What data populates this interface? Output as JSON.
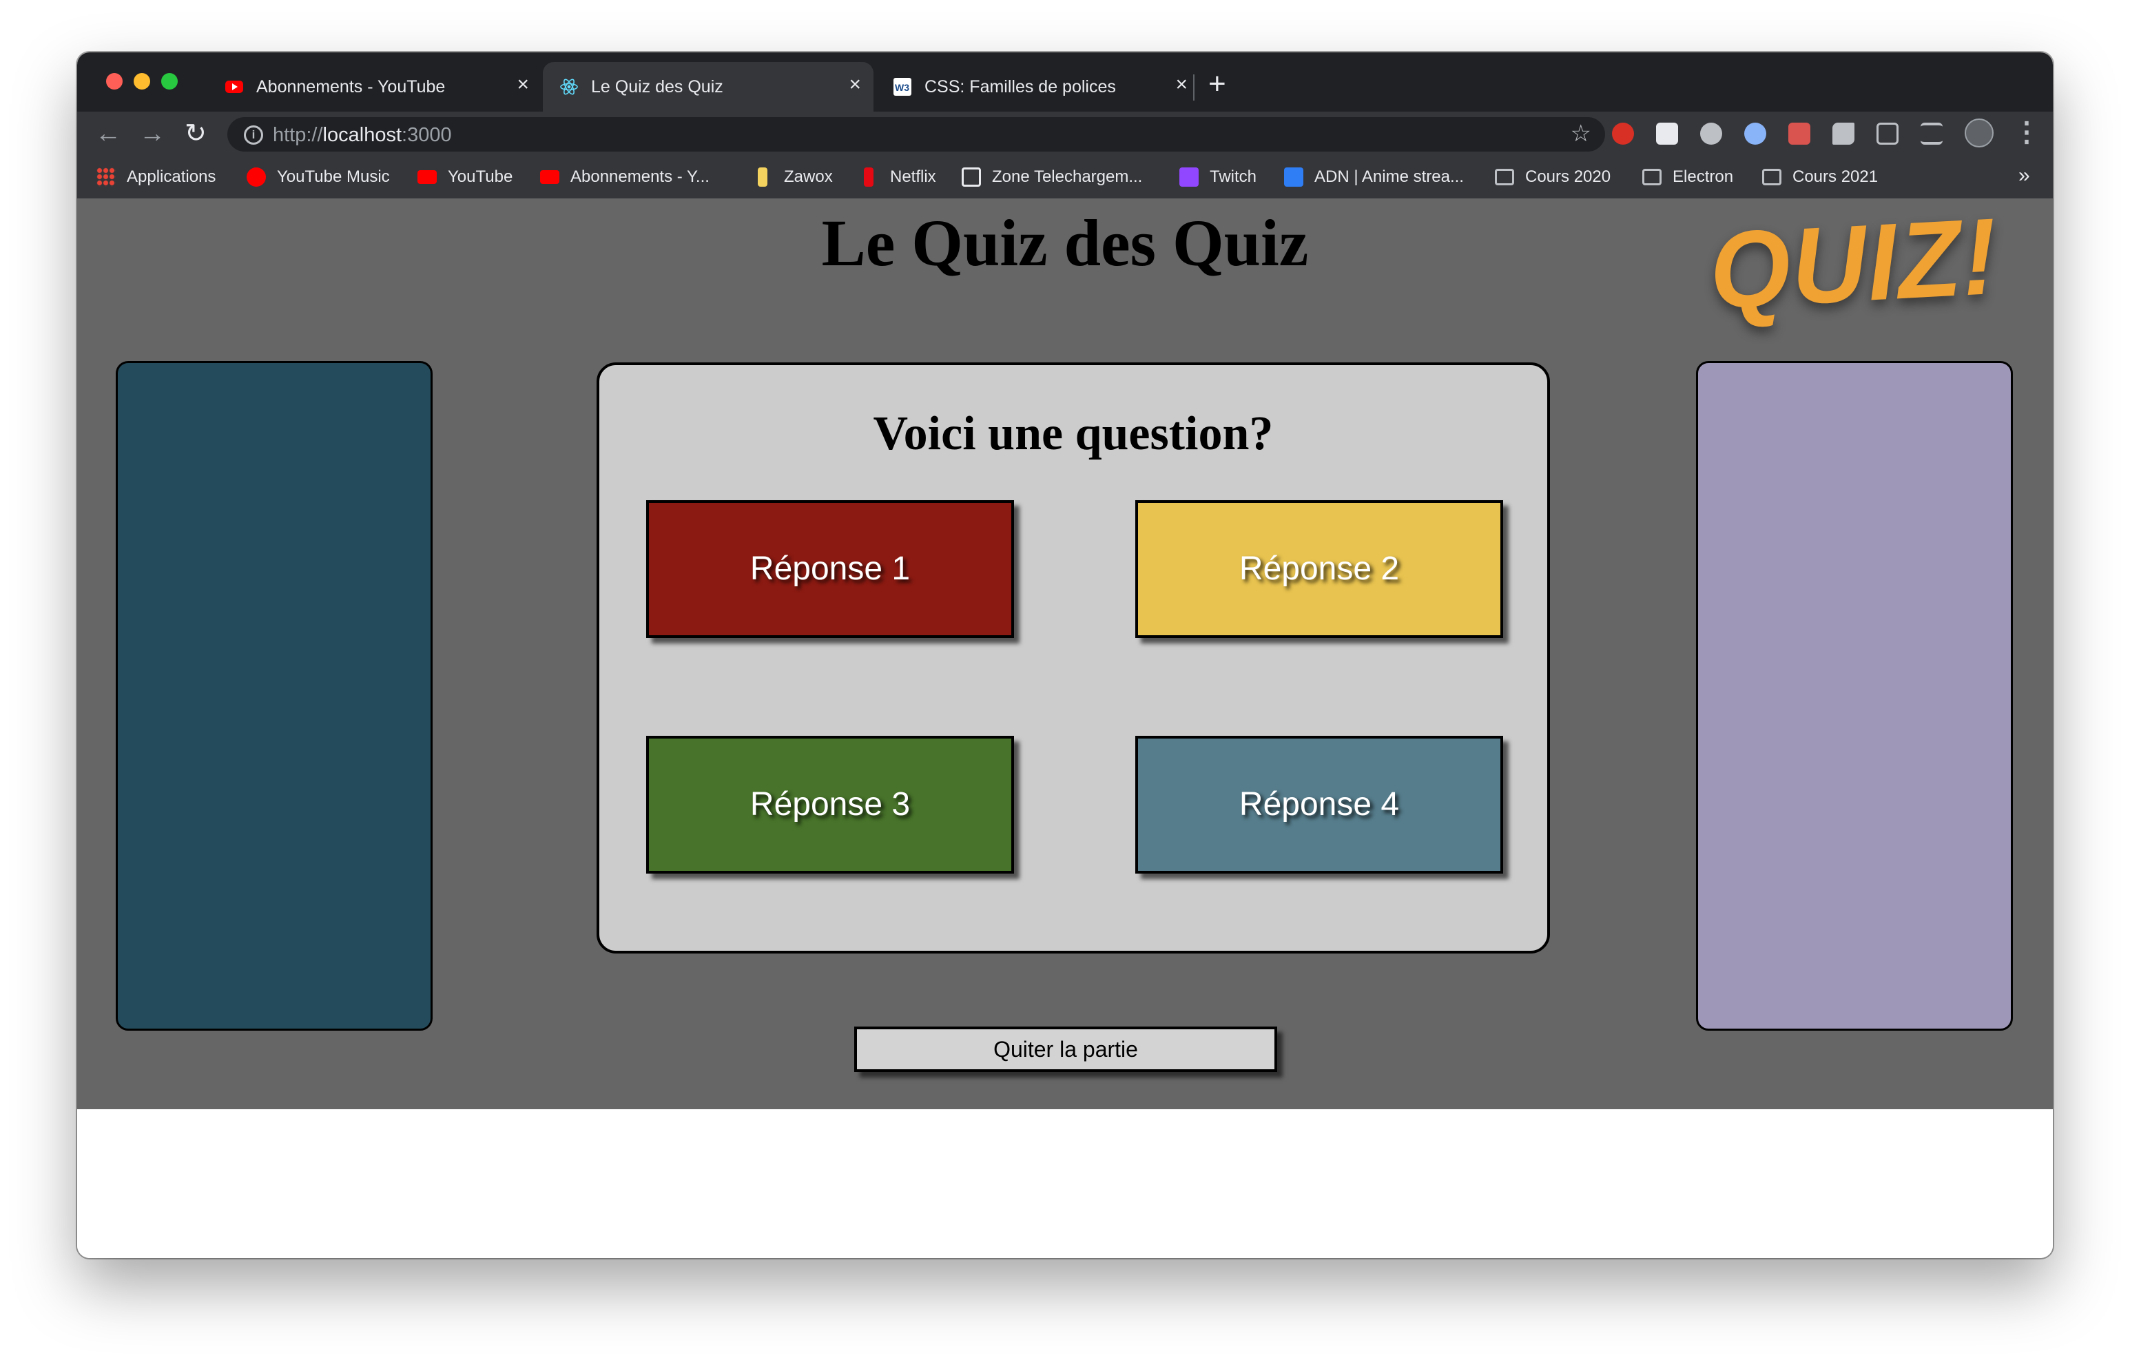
{
  "browser": {
    "tabs": [
      {
        "title": "Abonnements - YouTube",
        "icon": "youtube-icon",
        "close": "×"
      },
      {
        "title": "Le Quiz des Quiz",
        "icon": "react-icon",
        "close": "×",
        "active": true
      },
      {
        "title": "CSS: Familles de polices",
        "icon": "w3schools-icon",
        "close": "×"
      }
    ],
    "new_tab": "+",
    "address": {
      "scheme": "http://",
      "host": "localhost",
      "port": ":3000"
    },
    "bookmarks": [
      {
        "label": "Applications",
        "icon": "apps-grid-icon"
      },
      {
        "label": "YouTube Music",
        "icon": "youtube-music-icon"
      },
      {
        "label": "YouTube",
        "icon": "youtube-icon"
      },
      {
        "label": "Abonnements - Y...",
        "icon": "youtube-icon"
      },
      {
        "label": "Zawox",
        "icon": "zawox-icon"
      },
      {
        "label": "Netflix",
        "icon": "netflix-icon"
      },
      {
        "label": "Zone Telechargem...",
        "icon": "zt-icon"
      },
      {
        "label": "Twitch",
        "icon": "twitch-icon"
      },
      {
        "label": "ADN | Anime strea...",
        "icon": "adn-icon"
      },
      {
        "label": "Cours 2020",
        "icon": "folder-icon"
      },
      {
        "label": "Electron",
        "icon": "folder-icon"
      },
      {
        "label": "Cours 2021",
        "icon": "folder-icon"
      }
    ],
    "bookmarks_more": "»"
  },
  "page": {
    "title": "Le Quiz des Quiz",
    "logo": "QUIZ!",
    "question": "Voici une question?",
    "answers": [
      {
        "label": "Réponse 1",
        "color": "#8b1a12"
      },
      {
        "label": "Réponse 2",
        "color": "#e8c34f"
      },
      {
        "label": "Réponse 3",
        "color": "#47732a"
      },
      {
        "label": "Réponse 4",
        "color": "#567d8c"
      }
    ],
    "quit_label": "Quiter la partie",
    "colors": {
      "background": "#666666",
      "left_panel": "#244b5b",
      "right_panel": "#9e97b8",
      "card": "#cccccc"
    }
  }
}
